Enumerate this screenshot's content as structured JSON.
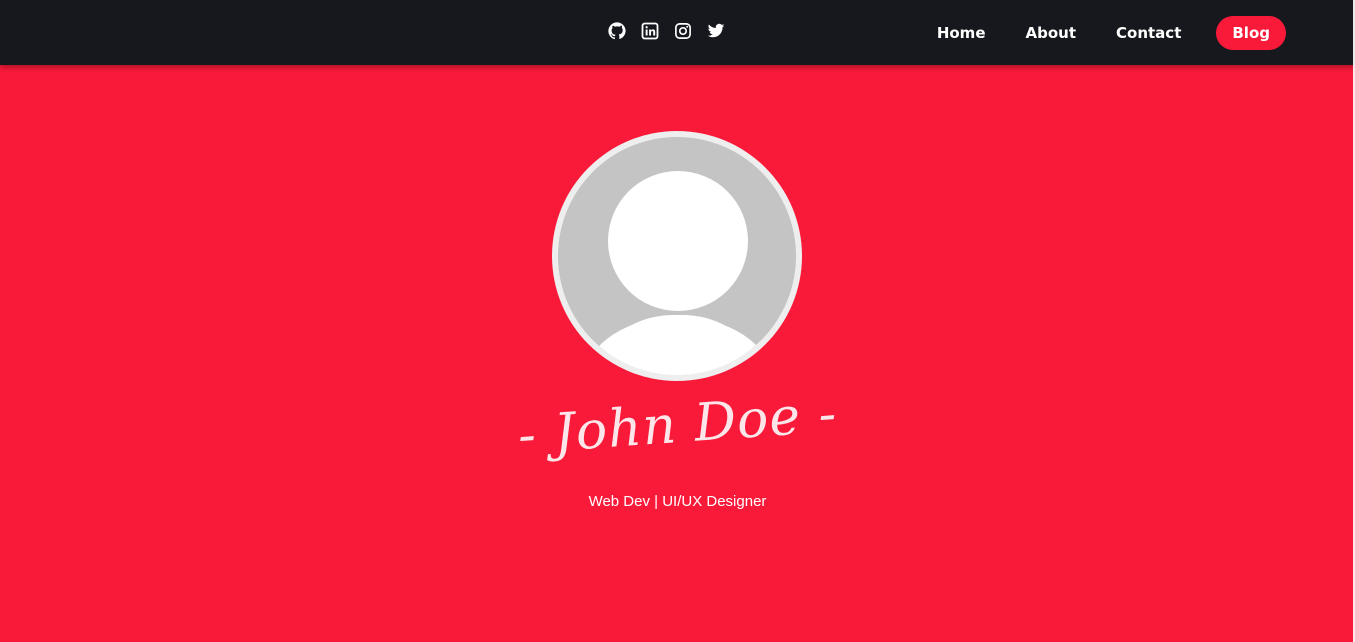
{
  "nav": {
    "social_icons": [
      "github-icon",
      "linkedin-icon",
      "instagram-icon",
      "twitter-icon"
    ],
    "links": [
      {
        "label": "Home"
      },
      {
        "label": "About"
      },
      {
        "label": "Contact"
      },
      {
        "label": "Blog"
      }
    ]
  },
  "hero": {
    "name": "- John Doe -",
    "tagline": "Web Dev | UI/UX Designer"
  },
  "colors": {
    "accent": "#f91a3a",
    "navbar": "#16181d",
    "avatar_bg": "#c4c4c4"
  }
}
